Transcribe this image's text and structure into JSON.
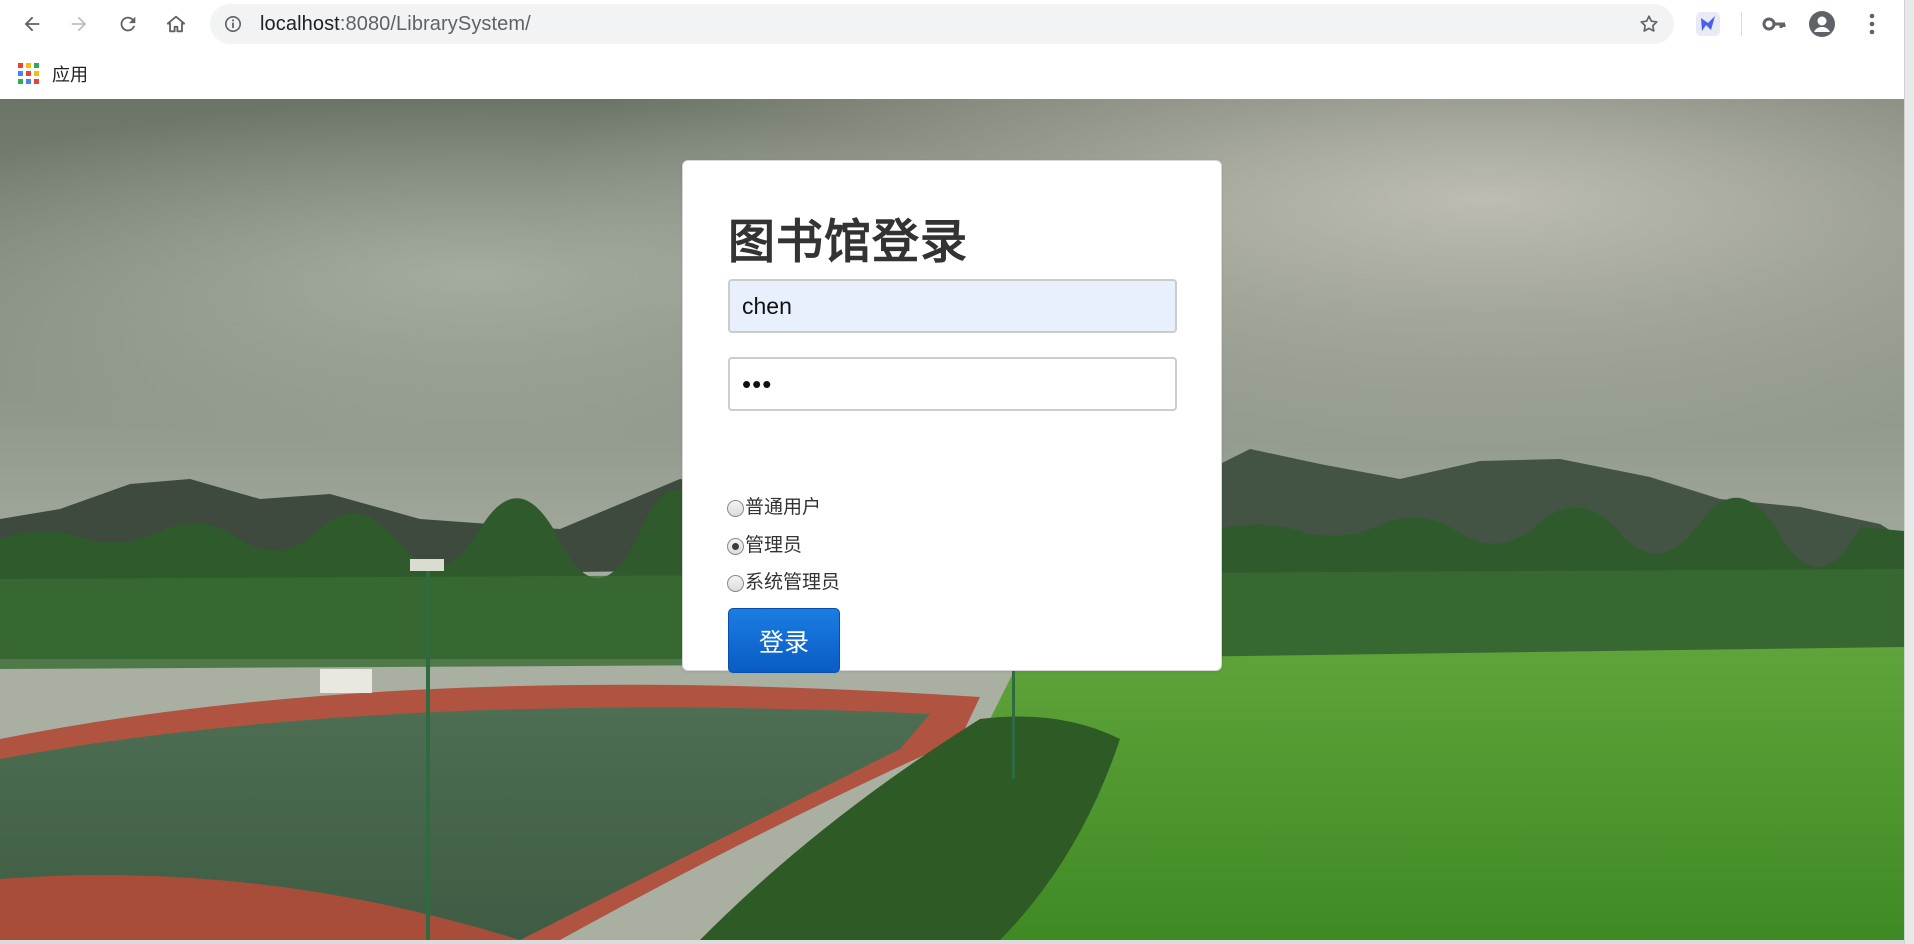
{
  "browser": {
    "url_host": "localhost",
    "url_rest": ":8080/LibrarySystem/",
    "bookmarks": {
      "apps_label": "应用"
    }
  },
  "login": {
    "title": "图书馆登录",
    "username_value": "chen",
    "password_value": "•••",
    "roles": [
      {
        "label": "普通用户",
        "checked": false
      },
      {
        "label": "管理员",
        "checked": true
      },
      {
        "label": "系统管理员",
        "checked": false
      }
    ],
    "submit_label": "登录"
  },
  "colors": {
    "primary_button": "#0a6bd6",
    "autofill_bg": "#e8f0fe"
  },
  "icons": [
    "back-arrow-icon",
    "forward-arrow-icon",
    "reload-icon",
    "home-icon",
    "site-info-icon",
    "bookmark-star-icon",
    "extension-icon",
    "key-icon",
    "profile-icon",
    "menu-icon",
    "apps-grid-icon"
  ]
}
